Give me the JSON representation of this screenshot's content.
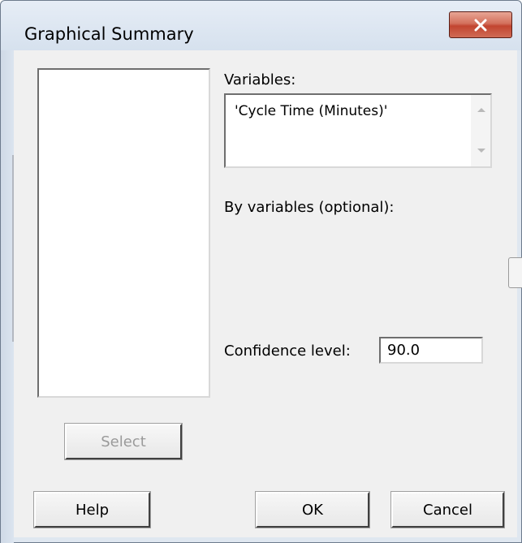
{
  "window": {
    "title": "Graphical Summary",
    "close_icon": "close-x-icon"
  },
  "form": {
    "variables_label": "Variables:",
    "variables_value": "'Cycle Time (Minutes)'",
    "by_variables_label": "By variables (optional):",
    "confidence_label": "Confidence level:",
    "confidence_value": "90.0"
  },
  "buttons": {
    "select": "Select",
    "help": "Help",
    "ok": "OK",
    "cancel": "Cancel"
  },
  "colors": {
    "close_button": "#c24530",
    "dialog_background": "#f0f0f0",
    "frame": "#dfe7f0"
  }
}
